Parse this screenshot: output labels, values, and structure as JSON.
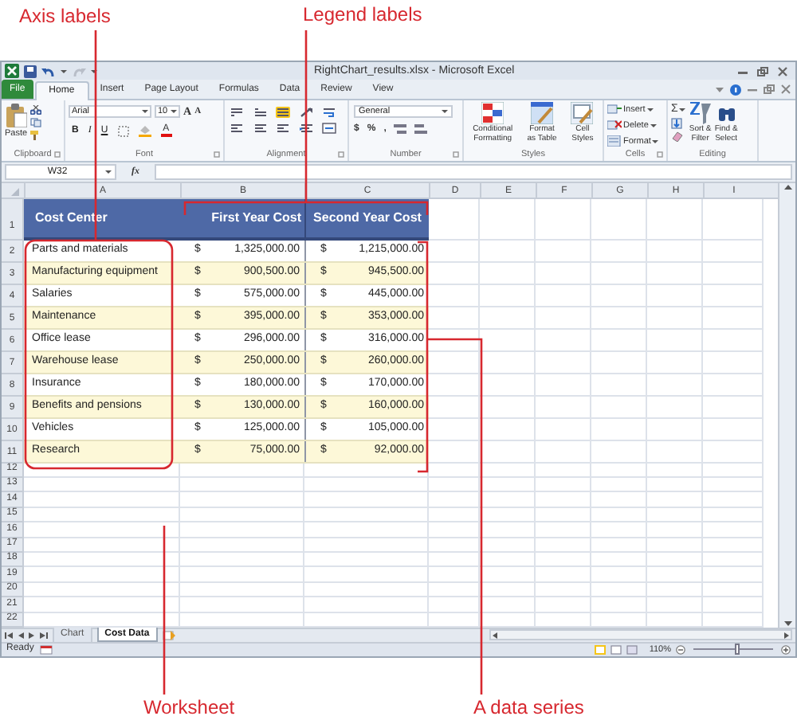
{
  "callouts": [
    {
      "text": "Axis labels"
    },
    {
      "text": "Legend labels"
    },
    {
      "text": "Worksheet"
    },
    {
      "text": "A data series"
    }
  ],
  "window": {
    "title": "RightChart_results.xlsx - Microsoft Excel"
  },
  "tabs": [
    {
      "label": "File",
      "kind": "file",
      "selected": false
    },
    {
      "label": "Home",
      "kind": "tab",
      "selected": true
    },
    {
      "label": "Insert",
      "kind": "tab",
      "selected": false
    },
    {
      "label": "Page Layout",
      "kind": "tab",
      "selected": false
    },
    {
      "label": "Formulas",
      "kind": "tab",
      "selected": false
    },
    {
      "label": "Data",
      "kind": "tab",
      "selected": false
    },
    {
      "label": "Review",
      "kind": "tab",
      "selected": false
    },
    {
      "label": "View",
      "kind": "tab",
      "selected": false
    }
  ],
  "ribbon": {
    "groups": [
      "Clipboard",
      "Font",
      "Alignment",
      "Number",
      "Styles",
      "Cells",
      "Editing"
    ],
    "paste": "Paste",
    "font_name": "Arial",
    "font_size": "10",
    "grow_shrink": [
      "A",
      "A"
    ],
    "font_buttons": [
      "B",
      "I",
      "U"
    ],
    "font_color": "A",
    "number_format": "General",
    "number_buttons": [
      "$",
      "%",
      ","
    ],
    "styles_buttons": [
      {
        "lines": [
          "Conditional",
          "Formatting"
        ]
      },
      {
        "lines": [
          "Format",
          "as Table"
        ]
      },
      {
        "lines": [
          "Cell",
          "Styles"
        ]
      }
    ],
    "cells_buttons": [
      "Insert",
      "Delete",
      "Format"
    ],
    "autosum": "Σ",
    "editing_buttons": [
      {
        "lines": [
          "Sort &",
          "Filter"
        ]
      },
      {
        "lines": [
          "Find &",
          "Select"
        ]
      }
    ]
  },
  "formula_bar": {
    "name_box": "W32",
    "function_label": "fx"
  },
  "columns": [
    "A",
    "B",
    "C",
    "D",
    "E",
    "F",
    "G",
    "H",
    "I"
  ],
  "table": {
    "header": [
      "Cost Center",
      "First Year Cost",
      "Second Year Cost"
    ],
    "rows": [
      {
        "label": "Parts and materials",
        "cells": [
          {
            "currency": "$",
            "amount": "1,325,000.00"
          },
          {
            "currency": "$",
            "amount": "1,215,000.00"
          }
        ]
      },
      {
        "label": "Manufacturing equipment",
        "cells": [
          {
            "currency": "$",
            "amount": "900,500.00"
          },
          {
            "currency": "$",
            "amount": "945,500.00"
          }
        ]
      },
      {
        "label": "Salaries",
        "cells": [
          {
            "currency": "$",
            "amount": "575,000.00"
          },
          {
            "currency": "$",
            "amount": "445,000.00"
          }
        ]
      },
      {
        "label": "Maintenance",
        "cells": [
          {
            "currency": "$",
            "amount": "395,000.00"
          },
          {
            "currency": "$",
            "amount": "353,000.00"
          }
        ]
      },
      {
        "label": "Office lease",
        "cells": [
          {
            "currency": "$",
            "amount": "296,000.00"
          },
          {
            "currency": "$",
            "amount": "316,000.00"
          }
        ]
      },
      {
        "label": "Warehouse lease",
        "cells": [
          {
            "currency": "$",
            "amount": "250,000.00"
          },
          {
            "currency": "$",
            "amount": "260,000.00"
          }
        ]
      },
      {
        "label": "Insurance",
        "cells": [
          {
            "currency": "$",
            "amount": "180,000.00"
          },
          {
            "currency": "$",
            "amount": "170,000.00"
          }
        ]
      },
      {
        "label": "Benefits and pensions",
        "cells": [
          {
            "currency": "$",
            "amount": "130,000.00"
          },
          {
            "currency": "$",
            "amount": "160,000.00"
          }
        ]
      },
      {
        "label": "Vehicles",
        "cells": [
          {
            "currency": "$",
            "amount": "125,000.00"
          },
          {
            "currency": "$",
            "amount": "105,000.00"
          }
        ]
      },
      {
        "label": "Research",
        "cells": [
          {
            "currency": "$",
            "amount": "75,000.00"
          },
          {
            "currency": "$",
            "amount": "92,000.00"
          }
        ]
      }
    ]
  },
  "row_numbers": [
    "1",
    "2",
    "3",
    "4",
    "5",
    "6",
    "7",
    "8",
    "9",
    "10",
    "11",
    "12",
    "13",
    "14",
    "15",
    "16",
    "17",
    "18",
    "19",
    "20",
    "21",
    "22"
  ],
  "sheet_tabs": [
    {
      "label": "Chart",
      "selected": false
    },
    {
      "label": "Cost Data",
      "selected": true
    }
  ],
  "status_bar": {
    "text": "Ready",
    "zoom": "110%",
    "zoom_slider": {
      "level": 0.55
    }
  }
}
